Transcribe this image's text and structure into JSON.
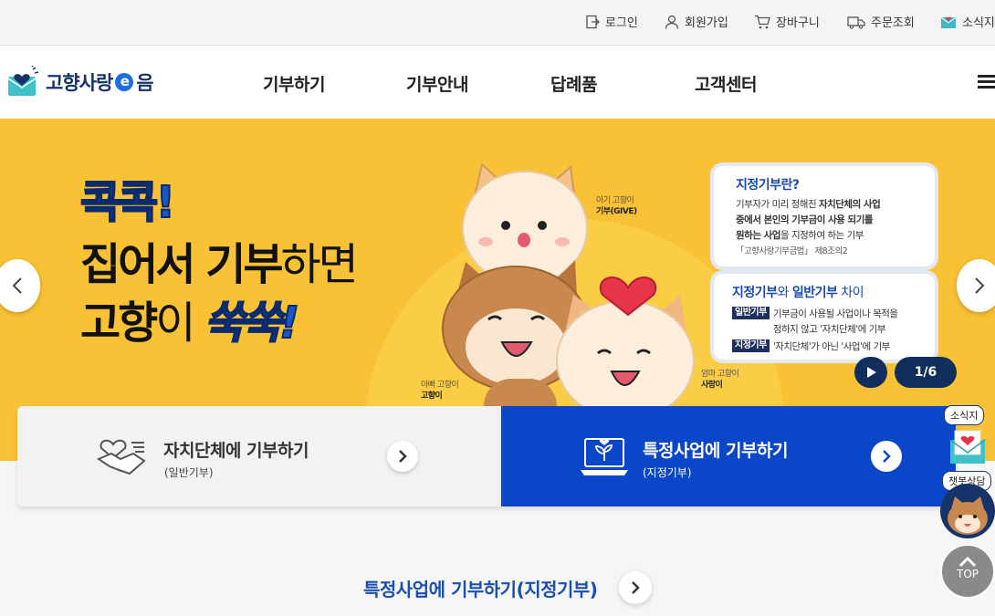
{
  "util_nav": [
    {
      "label": "로그인",
      "icon": "login-icon"
    },
    {
      "label": "회원가입",
      "icon": "person-icon"
    },
    {
      "label": "장바구니",
      "icon": "cart-icon"
    },
    {
      "label": "주문조회",
      "icon": "truck-icon"
    },
    {
      "label": "소식지",
      "icon": "newsletter-icon"
    }
  ],
  "logo": {
    "text_before": "고향사랑",
    "text_e": "e",
    "text_after": "음"
  },
  "gnb": [
    "기부하기",
    "기부안내",
    "답례품",
    "고객센터"
  ],
  "hero": {
    "kk": "콕콕!",
    "line1_bold": "집어서 기부",
    "line1_thin": "하면",
    "line2_bold": "고향",
    "line2_thin": "이 ",
    "line2_blue": "쑥쑥!",
    "char_top_small": "아기 고향이",
    "char_top_label": "기부(GIVE)",
    "char_left_small": "아빠 고향이",
    "char_left_label": "고향이",
    "char_right_small": "엄마 고향이",
    "char_right_label": "사랑이",
    "info1_title": "지정기부란?",
    "info1_body1_a": "기부자가 미리 정해진 ",
    "info1_body1_b": "자치단체의 사업",
    "info1_body2": "중에서 본인의 기부금이 사용 되기를",
    "info1_body3_a": "원하는 사업",
    "info1_body3_b": "을 지정하여 하는 기부",
    "info1_law": "「고향사랑기부금법」 제8조의2",
    "info2_title_a": "지정기부",
    "info2_title_b": "와 ",
    "info2_title_c": "일반기부",
    "info2_title_d": " 차이",
    "info2_tag1": "일반기부",
    "info2_row1a": "기부금이 사용될 사업이나 목적을",
    "info2_row1b": "정하지 않고 '자치단체'에 기부",
    "info2_tag2": "지정기부",
    "info2_row2": "'자치단체'가 아닌 '사업'에 기부",
    "pager": "1/6"
  },
  "cards": {
    "left_title": "자치단체에 기부하기",
    "left_sub": "(일반기부)",
    "right_title": "특정사업에 기부하기",
    "right_sub": "(지정기부)"
  },
  "section_title": "특정사업에 기부하기(지정기부)",
  "quick": {
    "news": "소식지",
    "chatbot": "챗봇상담",
    "top": "TOP"
  },
  "colors": {
    "brand_blue": "#0a47c8",
    "hero_yellow": "#f8c136",
    "navy": "#112f5d"
  }
}
